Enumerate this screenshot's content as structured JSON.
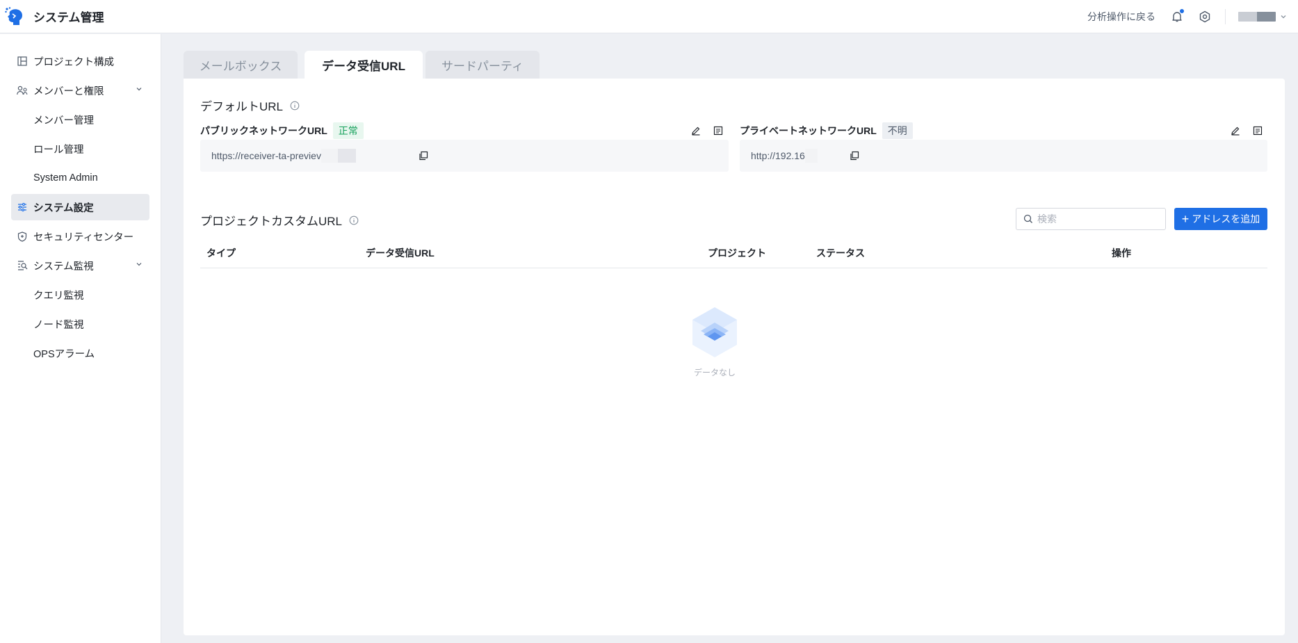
{
  "app": {
    "title": "システム管理"
  },
  "header": {
    "back_label": "分析操作に戻る",
    "accent": "#1f6fe5"
  },
  "sidebar": {
    "items": [
      {
        "label": "プロジェクト構成",
        "icon": "layout-icon"
      },
      {
        "label": "メンバーと権限",
        "icon": "users-icon"
      },
      {
        "label": "メンバー管理"
      },
      {
        "label": "ロール管理"
      },
      {
        "label": "System Admin"
      },
      {
        "label": "システム設定",
        "icon": "sliders-icon"
      },
      {
        "label": "セキュリティセンター",
        "icon": "shield-icon"
      },
      {
        "label": "システム監視",
        "icon": "monitor-search-icon"
      },
      {
        "label": "クエリ監視"
      },
      {
        "label": "ノード監視"
      },
      {
        "label": "OPSアラーム"
      }
    ]
  },
  "tabs": [
    "メールボックス",
    "データ受信URL",
    "サードパーティ"
  ],
  "default_url": {
    "title": "デフォルトURL",
    "public": {
      "label": "パブリックネットワークURL",
      "status": "正常",
      "url": "https://receiver-ta-previev"
    },
    "private": {
      "label": "プライベートネットワークURL",
      "status": "不明",
      "url": "http://192.16"
    }
  },
  "custom_url": {
    "title": "プロジェクトカスタムURL",
    "search_placeholder": "検索",
    "add_label": "アドレスを追加",
    "columns": [
      "タイプ",
      "データ受信URL",
      "プロジェクト",
      "ステータス",
      "操作"
    ],
    "empty_text": "データなし"
  }
}
